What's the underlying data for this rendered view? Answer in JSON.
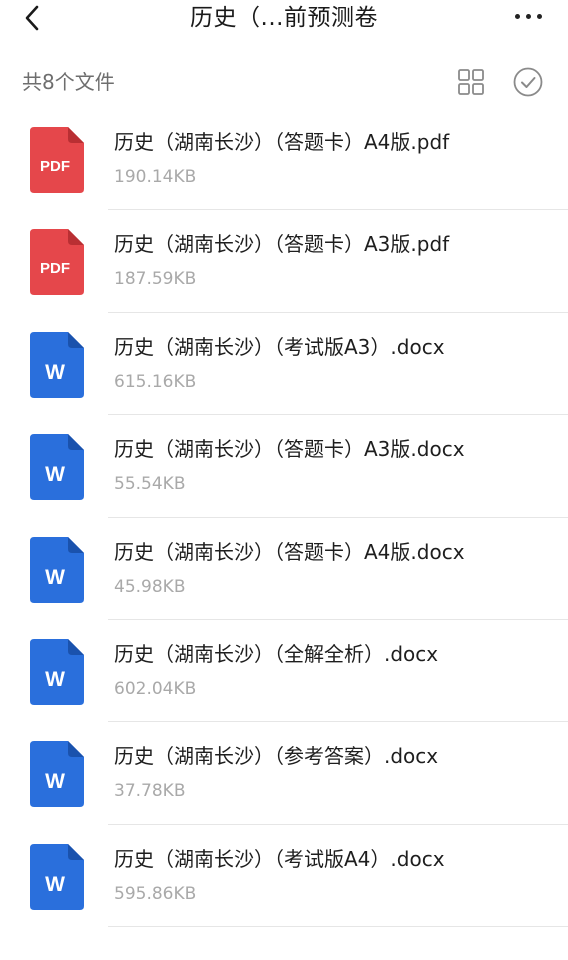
{
  "header": {
    "title": "历史（...前预测卷",
    "back_icon": "chevron-left-icon",
    "more_icon": "more-horizontal-icon"
  },
  "toolbar": {
    "file_count": "共8个文件",
    "grid_icon": "grid-view-icon",
    "select_icon": "check-circle-icon"
  },
  "colors": {
    "pdf": "#e5474b",
    "word": "#2a6fdc"
  },
  "files": [
    {
      "name": "历史（湖南长沙）（答题卡）A4版.pdf",
      "size": "190.14KB",
      "type": "pdf",
      "icon_label": "PDF"
    },
    {
      "name": "历史（湖南长沙）（答题卡）A3版.pdf",
      "size": "187.59KB",
      "type": "pdf",
      "icon_label": "PDF"
    },
    {
      "name": "历史（湖南长沙）（考试版A3）.docx",
      "size": "615.16KB",
      "type": "word",
      "icon_label": "W"
    },
    {
      "name": "历史（湖南长沙）（答题卡）A3版.docx",
      "size": "55.54KB",
      "type": "word",
      "icon_label": "W"
    },
    {
      "name": "历史（湖南长沙）（答题卡）A4版.docx",
      "size": "45.98KB",
      "type": "word",
      "icon_label": "W"
    },
    {
      "name": "历史（湖南长沙）（全解全析）.docx",
      "size": "602.04KB",
      "type": "word",
      "icon_label": "W"
    },
    {
      "name": "历史（湖南长沙）（参考答案）.docx",
      "size": "37.78KB",
      "type": "word",
      "icon_label": "W"
    },
    {
      "name": "历史（湖南长沙）（考试版A4）.docx",
      "size": "595.86KB",
      "type": "word",
      "icon_label": "W"
    }
  ]
}
